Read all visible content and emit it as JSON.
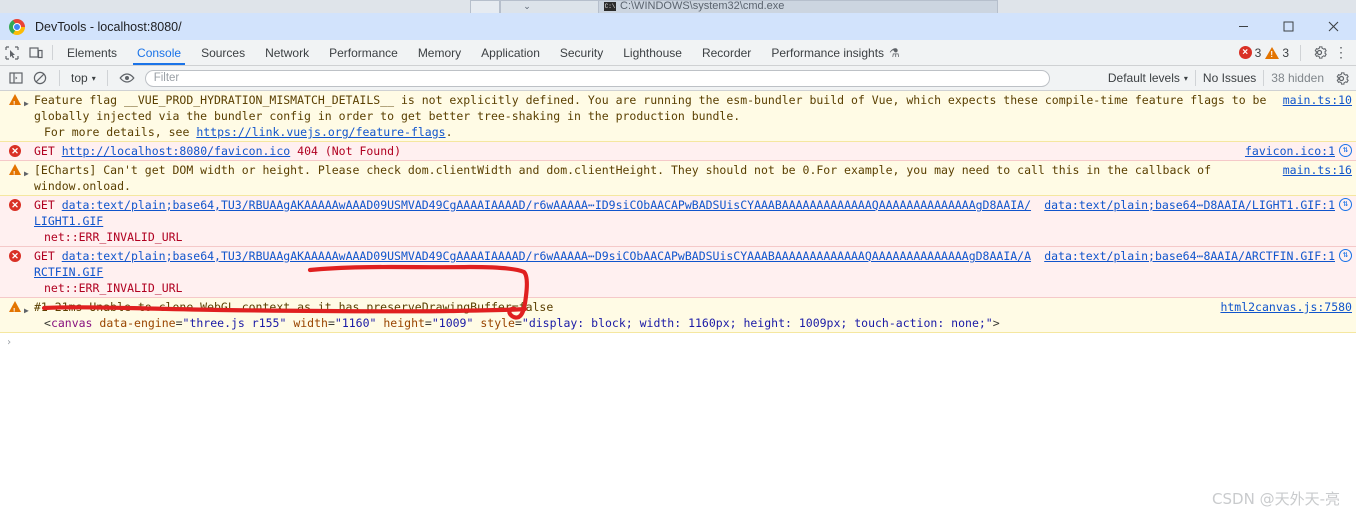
{
  "background_windows": {
    "cmd_title": "C:\\WINDOWS\\system32\\cmd.exe",
    "cmd_icon": "cmd-icon",
    "chevron": "⌄"
  },
  "titlebar": {
    "title": "DevTools - localhost:8080/",
    "logo": "chrome-logo",
    "minimize": "─",
    "maximize": "□",
    "close": "✕"
  },
  "tabbar": {
    "inspect_icon": "inspect-element-icon",
    "device_icon": "device-toolbar-icon",
    "tabs": [
      {
        "label": "Elements",
        "active": false
      },
      {
        "label": "Console",
        "active": true
      },
      {
        "label": "Sources",
        "active": false
      },
      {
        "label": "Network",
        "active": false
      },
      {
        "label": "Performance",
        "active": false
      },
      {
        "label": "Memory",
        "active": false
      },
      {
        "label": "Application",
        "active": false
      },
      {
        "label": "Security",
        "active": false
      },
      {
        "label": "Lighthouse",
        "active": false
      },
      {
        "label": "Recorder",
        "active": false
      },
      {
        "label": "Performance insights",
        "active": false,
        "flask": "⚗"
      }
    ],
    "error_count": "3",
    "warning_count": "3",
    "error_glyph": "×",
    "settings_icon": "gear-icon",
    "more_icon": "⋮"
  },
  "console_toolbar": {
    "sidebar_icon": "console-sidebar-icon",
    "clear_icon": "clear-console-icon",
    "context": "top",
    "context_caret": "▾",
    "eye_icon": "live-expression-icon",
    "filter_placeholder": "Filter",
    "filter_value": "",
    "levels_label": "Default levels",
    "levels_caret": "▾",
    "issues_label": "No Issues",
    "hidden_label": "38 hidden",
    "settings_icon": "gear-icon"
  },
  "messages": [
    {
      "type": "warning",
      "expandable": true,
      "text": "Feature flag __VUE_PROD_HYDRATION_MISMATCH_DETAILS__ is not explicitly defined. You are running the esm-bundler build of Vue, which expects these compile-time feature flags to be globally injected via the bundler config in order to get better tree-shaking in the production bundle.",
      "source": "main.ts:10",
      "extra_text_prefix": "For more details, see ",
      "extra_link": "https://link.vuejs.org/feature-flags",
      "extra_text_suffix": "."
    },
    {
      "type": "error",
      "expandable": false,
      "method": "GET",
      "url": "http://localhost:8080/favicon.ico",
      "status": "404 (Not Found)",
      "source": "favicon.ico:1",
      "net_icon": "network-request-icon"
    },
    {
      "type": "warning",
      "expandable": true,
      "text": "[ECharts] Can't get DOM width or height. Please check dom.clientWidth and dom.clientHeight. They should not be 0.For example, you may need to call this in the callback of window.onload.",
      "source": "main.ts:16"
    },
    {
      "type": "error",
      "expandable": false,
      "method": "GET",
      "url": "data:text/plain;base64,TU3/RBUAAgAKAAAAAwAAAD09USMVAD49CgAAAAIAAAAD/r6wAAAAA⋯ID9siCObAACAPwBADSUisCYAAABAAAAAAAAAAAAAQAAAAAAAAAAAAAAgD8AAIA/LIGHT1.GIF",
      "status": "",
      "net_error": "net::ERR_INVALID_URL",
      "source": "data:text/plain;base64⋯D8AAIA/LIGHT1.GIF:1",
      "net_icon": "network-request-icon"
    },
    {
      "type": "error",
      "expandable": false,
      "method": "GET",
      "url": "data:text/plain;base64,TU3/RBUAAgAKAAAAAwAAAD09USMVAD49CgAAAAIAAAAD/r6wAAAAA⋯D9siCObAACAPwBADSUisCYAAABAAAAAAAAAAAAAQAAAAAAAAAAAAAAgD8AAIA/ARCTFIN.GIF",
      "status": "",
      "net_error": "net::ERR_INVALID_URL",
      "source": "data:text/plain;base64⋯8AAIA/ARCTFIN.GIF:1",
      "net_icon": "network-request-icon"
    },
    {
      "type": "warning",
      "expandable": true,
      "text": "#1 21ms Unable to clone WebGL context as it has preserveDrawingBuffer=false",
      "source": "html2canvas.js:7580",
      "code": {
        "open": "<",
        "tag": "canvas",
        "attrs": [
          {
            "name": "data-engine",
            "value": "\"three.js r155\""
          },
          {
            "name": "width",
            "value": "\"1160\""
          },
          {
            "name": "height",
            "value": "\"1009\""
          },
          {
            "name": "style",
            "value": "\"display: block; width: 1160px; height: 1009px; touch-action: none;\""
          }
        ],
        "close": ">"
      }
    }
  ],
  "prompt": {
    "caret": "›"
  },
  "annotation": {
    "color": "#e02020",
    "shape": "hand-drawn-rectangle"
  },
  "watermark": {
    "text": "CSDN @天外天-亮"
  }
}
